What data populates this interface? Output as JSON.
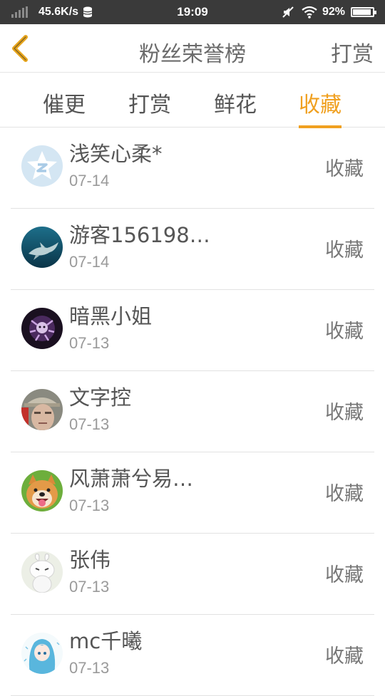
{
  "status_bar": {
    "speed": "45.6K/s",
    "time": "19:09",
    "battery": "92%",
    "battery_level": 0.92
  },
  "header": {
    "title": "粉丝荣誉榜",
    "right_action": "打赏"
  },
  "tabs": [
    {
      "label": "催更",
      "active": false
    },
    {
      "label": "打赏",
      "active": false
    },
    {
      "label": "鲜花",
      "active": false
    },
    {
      "label": "收藏",
      "active": true
    }
  ],
  "list": [
    {
      "name": "浅笑心柔*",
      "date": "07-14",
      "action": "收藏"
    },
    {
      "name": "游客156198…",
      "date": "07-14",
      "action": "收藏"
    },
    {
      "name": "暗黑小姐",
      "date": "07-13",
      "action": "收藏"
    },
    {
      "name": "文字控",
      "date": "07-13",
      "action": "收藏"
    },
    {
      "name": "风萧萧兮易…",
      "date": "07-13",
      "action": "收藏"
    },
    {
      "name": "张伟",
      "date": "07-13",
      "action": "收藏"
    },
    {
      "name": "mc千曦",
      "date": "07-13",
      "action": "收藏"
    }
  ],
  "colors": {
    "accent": "#f0a020",
    "status_bar_bg": "#3a3a3a"
  }
}
